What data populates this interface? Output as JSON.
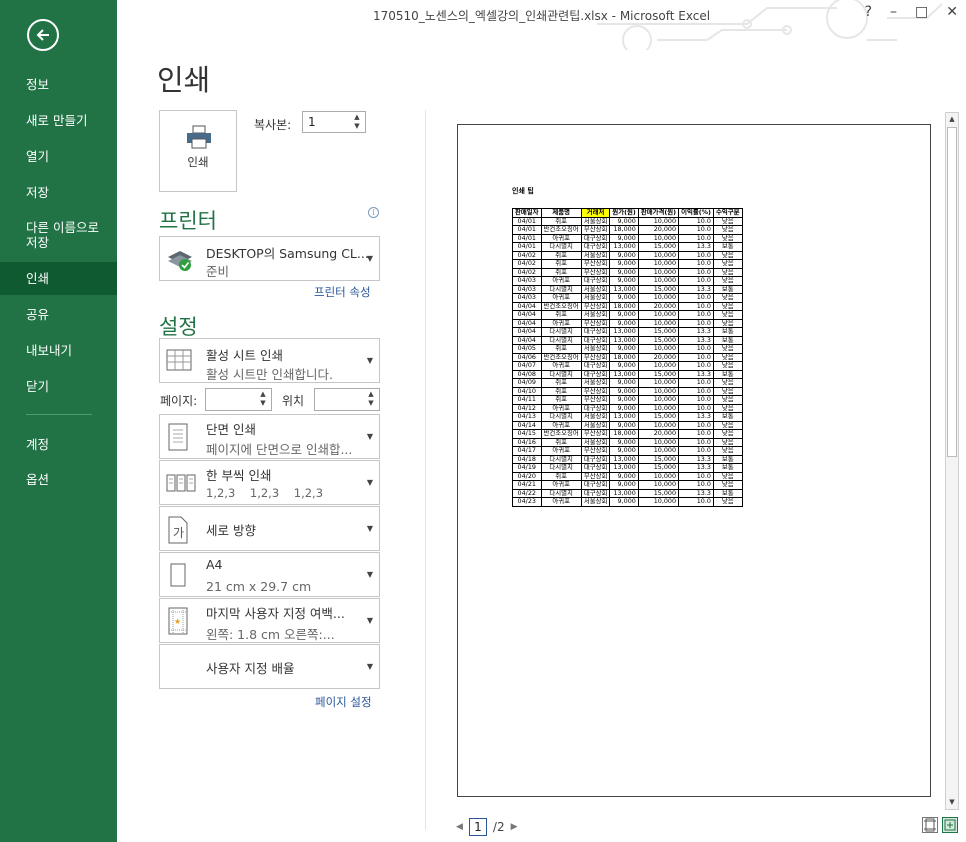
{
  "window": {
    "title": "170510_노센스의_엑셀강의_인쇄관련팁.xlsx - Microsoft Excel",
    "help": "?",
    "minimize": "–",
    "restore": "□",
    "close": "✕"
  },
  "sidebar": {
    "items": [
      {
        "label": "정보"
      },
      {
        "label": "새로 만들기"
      },
      {
        "label": "열기"
      },
      {
        "label": "저장"
      },
      {
        "label": "다른 이름으로\n저장"
      },
      {
        "label": "인쇄"
      },
      {
        "label": "공유"
      },
      {
        "label": "내보내기"
      },
      {
        "label": "닫기"
      },
      {
        "label": "계정"
      },
      {
        "label": "옵션"
      }
    ]
  },
  "print": {
    "title": "인쇄",
    "button_label": "인쇄",
    "copies_label": "복사본:",
    "copies_value": "1"
  },
  "printer": {
    "heading": "프린터",
    "name": "DESKTOP의 Samsung CL...",
    "status": "준비",
    "properties_link": "프린터 속성"
  },
  "settings": {
    "heading": "설정",
    "what": {
      "line1": "활성 시트 인쇄",
      "line2": "활성 시트만 인쇄합니다."
    },
    "pages_label": "페이지:",
    "to_label": "위치",
    "sides": {
      "line1": "단면 인쇄",
      "line2": "페이지에 단면으로 인쇄합..."
    },
    "collate": {
      "line1": "한 부씩 인쇄",
      "line2": "1,2,3    1,2,3    1,2,3"
    },
    "orientation": {
      "line1": "세로 방향"
    },
    "paper": {
      "line1": "A4",
      "line2": "21 cm x 29.7 cm"
    },
    "margins": {
      "line1": "마지막 사용자 지정 여백...",
      "line2": "왼쪽:  1.8 cm    오른쪽:..."
    },
    "scaling": {
      "line1": "사용자 지정 배율"
    },
    "page_setup_link": "페이지 설정"
  },
  "preview": {
    "sheet_title": "인쇄 팁",
    "headers": [
      "판매일자",
      "제품명",
      "거래처",
      "원가(원)",
      "판매가격(원)",
      "이익률(%)",
      "수익구분"
    ],
    "rows": [
      [
        "04/01",
        "쥐포",
        "서울상회",
        "9,000",
        "10,000",
        "10.0",
        "낮음"
      ],
      [
        "04/01",
        "반건조오징어",
        "부산상회",
        "18,000",
        "20,000",
        "10.0",
        "낮음"
      ],
      [
        "04/01",
        "아귀포",
        "대구상회",
        "9,000",
        "10,000",
        "10.0",
        "낮음"
      ],
      [
        "04/01",
        "다시멸치",
        "대구상회",
        "13,000",
        "15,000",
        "13.3",
        "보통"
      ],
      [
        "04/02",
        "쥐포",
        "서울상회",
        "9,000",
        "10,000",
        "10.0",
        "낮음"
      ],
      [
        "04/02",
        "쥐포",
        "부산상회",
        "9,000",
        "10,000",
        "10.0",
        "낮음"
      ],
      [
        "04/02",
        "쥐포",
        "부산상회",
        "9,000",
        "10,000",
        "10.0",
        "낮음"
      ],
      [
        "04/03",
        "아귀포",
        "대구상회",
        "9,000",
        "10,000",
        "10.0",
        "낮음"
      ],
      [
        "04/03",
        "다시멸치",
        "서울상회",
        "13,000",
        "15,000",
        "13.3",
        "보통"
      ],
      [
        "04/03",
        "아귀포",
        "서울상회",
        "9,000",
        "10,000",
        "10.0",
        "낮음"
      ],
      [
        "04/04",
        "반건조오징어",
        "부산상회",
        "18,000",
        "20,000",
        "10.0",
        "낮음"
      ],
      [
        "04/04",
        "쥐포",
        "서울상회",
        "9,000",
        "10,000",
        "10.0",
        "낮음"
      ],
      [
        "04/04",
        "아귀포",
        "부산상회",
        "9,000",
        "10,000",
        "10.0",
        "낮음"
      ],
      [
        "04/04",
        "다시멸치",
        "대구상회",
        "13,000",
        "15,000",
        "13.3",
        "보통"
      ],
      [
        "04/04",
        "다시멸치",
        "대구상회",
        "13,000",
        "15,000",
        "13.3",
        "보통"
      ],
      [
        "04/05",
        "쥐포",
        "서울상회",
        "9,000",
        "10,000",
        "10.0",
        "낮음"
      ],
      [
        "04/06",
        "반건조오징어",
        "부산상회",
        "18,000",
        "20,000",
        "10.0",
        "낮음"
      ],
      [
        "04/07",
        "아귀포",
        "대구상회",
        "9,000",
        "10,000",
        "10.0",
        "낮음"
      ],
      [
        "04/08",
        "다시멸치",
        "대구상회",
        "13,000",
        "15,000",
        "13.3",
        "보통"
      ],
      [
        "04/09",
        "쥐포",
        "서울상회",
        "9,000",
        "10,000",
        "10.0",
        "낮음"
      ],
      [
        "04/10",
        "쥐포",
        "부산상회",
        "9,000",
        "10,000",
        "10.0",
        "낮음"
      ],
      [
        "04/11",
        "쥐포",
        "부산상회",
        "9,000",
        "10,000",
        "10.0",
        "낮음"
      ],
      [
        "04/12",
        "아귀포",
        "대구상회",
        "9,000",
        "10,000",
        "10.0",
        "낮음"
      ],
      [
        "04/13",
        "다시멸치",
        "서울상회",
        "13,000",
        "15,000",
        "13.3",
        "보통"
      ],
      [
        "04/14",
        "아귀포",
        "서울상회",
        "9,000",
        "10,000",
        "10.0",
        "낮음"
      ],
      [
        "04/15",
        "반건조오징어",
        "부산상회",
        "18,000",
        "20,000",
        "10.0",
        "낮음"
      ],
      [
        "04/16",
        "쥐포",
        "서울상회",
        "9,000",
        "10,000",
        "10.0",
        "낮음"
      ],
      [
        "04/17",
        "아귀포",
        "부산상회",
        "9,000",
        "10,000",
        "10.0",
        "낮음"
      ],
      [
        "04/18",
        "다시멸치",
        "대구상회",
        "13,000",
        "15,000",
        "13.3",
        "보통"
      ],
      [
        "04/19",
        "다시멸치",
        "대구상회",
        "13,000",
        "15,000",
        "13.3",
        "보통"
      ],
      [
        "04/20",
        "쥐포",
        "부산상회",
        "9,000",
        "10,000",
        "10.0",
        "낮음"
      ],
      [
        "04/21",
        "아귀포",
        "대구상회",
        "9,000",
        "10,000",
        "10.0",
        "낮음"
      ],
      [
        "04/22",
        "다시멸치",
        "대구상회",
        "13,000",
        "15,000",
        "13.3",
        "보통"
      ],
      [
        "04/23",
        "아귀포",
        "서울상회",
        "9,000",
        "10,000",
        "10.0",
        "낮음"
      ]
    ]
  },
  "pager": {
    "current": "1",
    "total": "/2"
  },
  "colors": {
    "sidebar": "#217346",
    "sidebar_active": "#0f5a31",
    "accent": "#217346",
    "link": "#2b579a",
    "highlight": "#ffff00"
  }
}
